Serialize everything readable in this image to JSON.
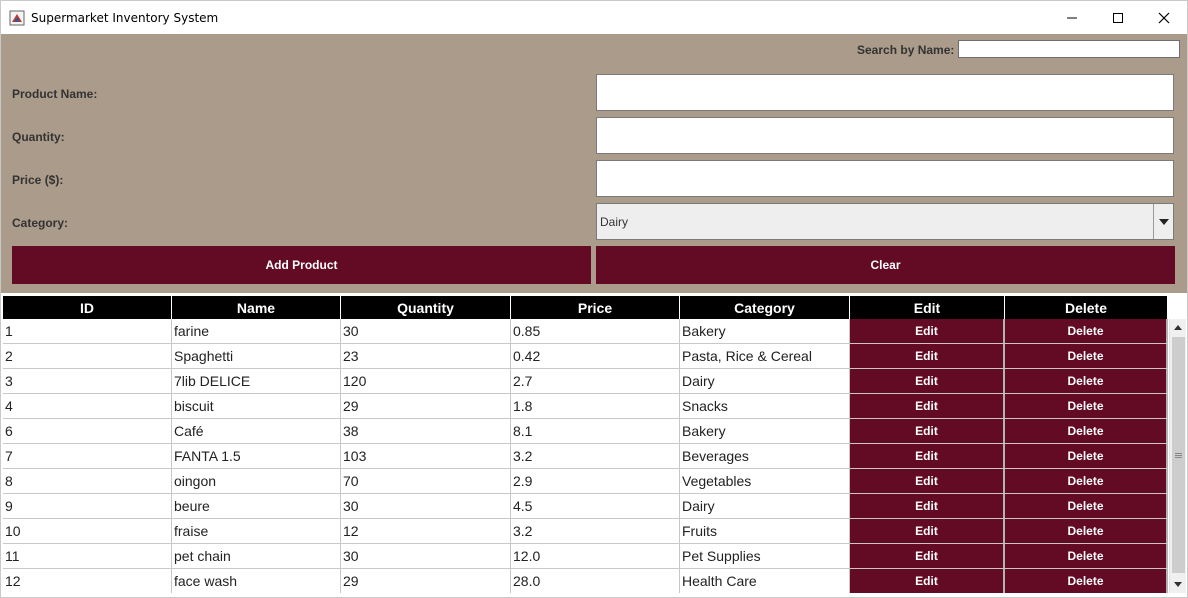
{
  "window": {
    "title": "Supermarket Inventory System"
  },
  "search": {
    "label": "Search by Name:",
    "value": ""
  },
  "form": {
    "product_name_label": "Product Name:",
    "quantity_label": "Quantity:",
    "price_label": "Price ($):",
    "category_label": "Category:",
    "product_name_value": "",
    "quantity_value": "",
    "price_value": "",
    "category_value": "Dairy",
    "add_button": "Add Product",
    "clear_button": "Clear"
  },
  "table": {
    "columns": [
      "ID",
      "Name",
      "Quantity",
      "Price",
      "Category",
      "Edit",
      "Delete"
    ],
    "rows": [
      {
        "id": "1",
        "name": "farine",
        "quantity": "30",
        "price": "0.85",
        "category": "Bakery"
      },
      {
        "id": "2",
        "name": "Spaghetti",
        "quantity": "23",
        "price": "0.42",
        "category": "Pasta, Rice & Cereal"
      },
      {
        "id": "3",
        "name": "7lib DELICE",
        "quantity": "120",
        "price": "2.7",
        "category": "Dairy"
      },
      {
        "id": "4",
        "name": "biscuit",
        "quantity": "29",
        "price": "1.8",
        "category": "Snacks"
      },
      {
        "id": "6",
        "name": "Café",
        "quantity": "38",
        "price": "8.1",
        "category": "Bakery"
      },
      {
        "id": "7",
        "name": "FANTA 1.5",
        "quantity": "103",
        "price": "3.2",
        "category": "Beverages"
      },
      {
        "id": "8",
        "name": "oingon",
        "quantity": "70",
        "price": "2.9",
        "category": "Vegetables"
      },
      {
        "id": "9",
        "name": "beure",
        "quantity": "30",
        "price": "4.5",
        "category": "Dairy"
      },
      {
        "id": "10",
        "name": "fraise",
        "quantity": "12",
        "price": "3.2",
        "category": "Fruits"
      },
      {
        "id": "11",
        "name": "pet chain",
        "quantity": "30",
        "price": "12.0",
        "category": "Pet Supplies"
      },
      {
        "id": "12",
        "name": "face wash",
        "quantity": "29",
        "price": "28.0",
        "category": "Health Care"
      }
    ],
    "edit_label": "Edit",
    "delete_label": "Delete"
  },
  "colors": {
    "panel_bg": "#ab9b8b",
    "button_bg": "#630a24",
    "header_bg": "#000000"
  },
  "icons": [
    "app-icon",
    "minimize-icon",
    "maximize-icon",
    "close-icon",
    "dropdown-arrow-icon",
    "scroll-up-icon",
    "scroll-down-icon"
  ]
}
